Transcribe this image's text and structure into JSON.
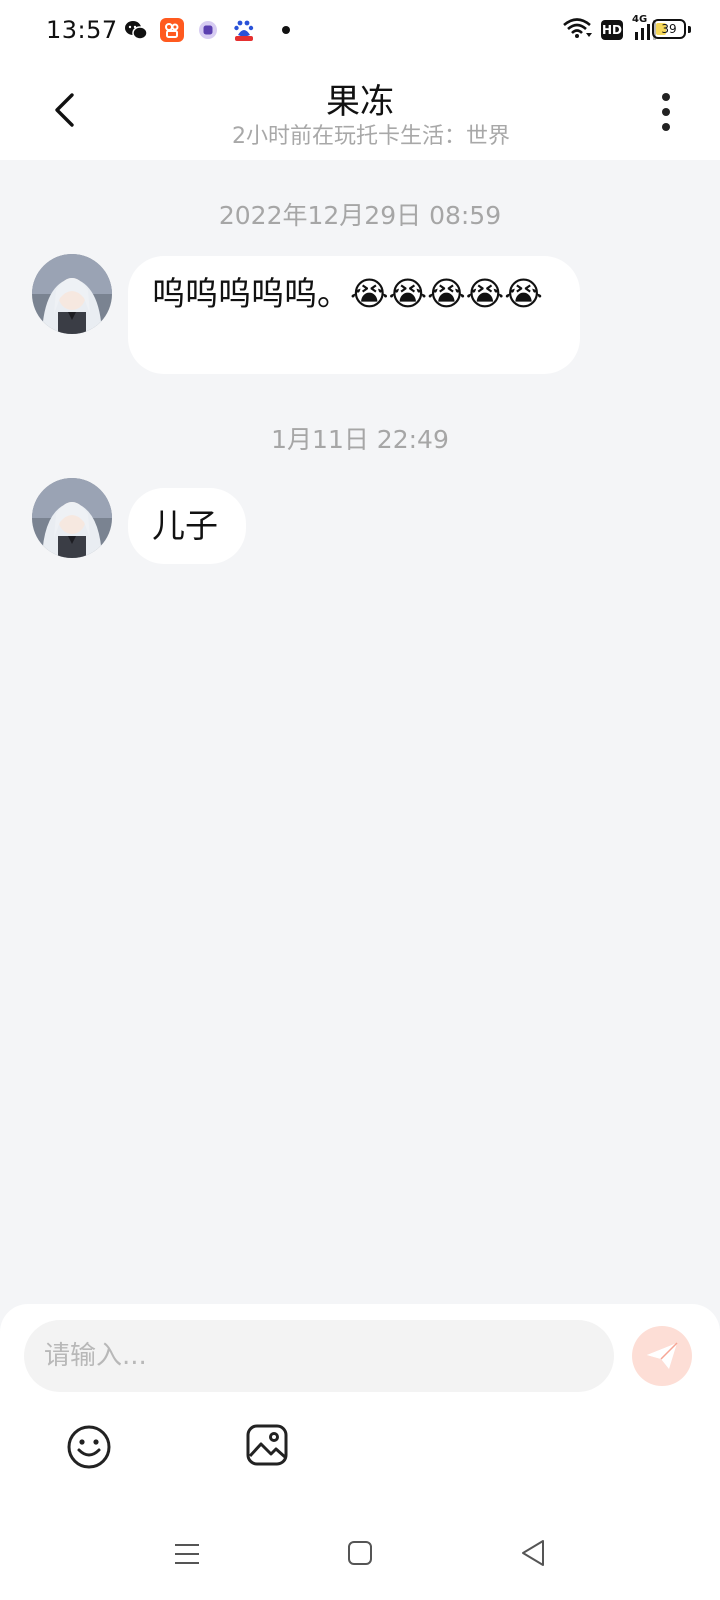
{
  "status_bar": {
    "time": "13:57",
    "app_icons": [
      "wechat-icon",
      "kuaishou-icon",
      "purple-app-icon",
      "baidu-icon"
    ],
    "signal_label": "4G",
    "hd_label": "HD",
    "battery_level": "39",
    "battery_fraction": 0.39
  },
  "header": {
    "title": "果冻",
    "subtitle": "2小时前在玩托卡生活：世界"
  },
  "messages": [
    {
      "timestamp": "2022年12月29日 08:59",
      "text": "呜呜呜呜呜。😭😭😭😭😭"
    },
    {
      "timestamp": "1月11日 22:49",
      "text": "儿子"
    }
  ],
  "input": {
    "placeholder": "请输入..."
  },
  "toolbar": {
    "emoji_icon": "smiley-icon",
    "image_icon": "image-icon",
    "send_icon": "paper-plane-icon"
  },
  "colors": {
    "background": "#f4f5f7",
    "bubble": "#ffffff",
    "send_button": "#fdded6",
    "send_arrow": "#f7a594"
  }
}
